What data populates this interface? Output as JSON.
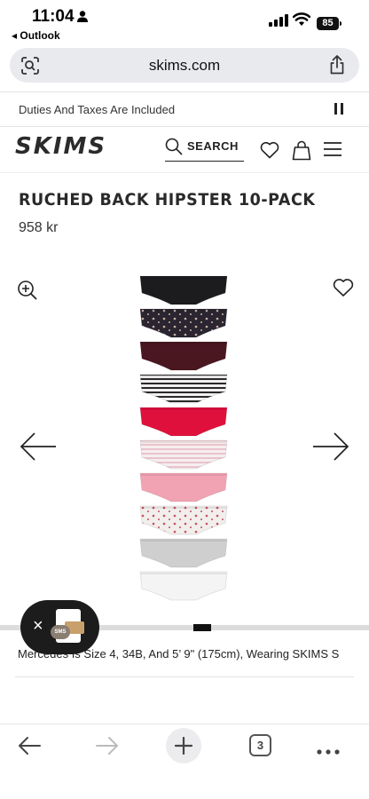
{
  "status_bar": {
    "time": "11:04",
    "back_app": "◂ Outlook",
    "battery": "85"
  },
  "browser": {
    "url": "skims.com",
    "tab_count": "3"
  },
  "site": {
    "announcement": "Duties And Taxes Are Included",
    "logo": "SKIMS",
    "search_label": "SEARCH"
  },
  "product": {
    "title": "RUCHED BACK HIPSTER 10-PACK",
    "price": "958 kr",
    "model_caption": "Mercedes Is Size 4, 34B, And 5’ 9\" (175cm), Wearing SKIMS S",
    "gallery_progress": 0.55,
    "swatches": [
      {
        "name": "black",
        "base": "#1c1c1e",
        "pattern": "none",
        "accent": ""
      },
      {
        "name": "black-print",
        "base": "#2a2530",
        "pattern": "dots",
        "accent": "#c9b2a8"
      },
      {
        "name": "burgundy",
        "base": "#4a1620",
        "pattern": "none",
        "accent": ""
      },
      {
        "name": "black-stripe",
        "base": "#f3eef0",
        "pattern": "stripes",
        "accent": "#2a2a2a"
      },
      {
        "name": "red",
        "base": "#e0103d",
        "pattern": "none",
        "accent": ""
      },
      {
        "name": "pink-stripe",
        "base": "#f6edef",
        "pattern": "stripes",
        "accent": "#e9c4cc"
      },
      {
        "name": "pink",
        "base": "#f2a3b3",
        "pattern": "none",
        "accent": ""
      },
      {
        "name": "white-cherry",
        "base": "#f1eeec",
        "pattern": "dots",
        "accent": "#c7505e"
      },
      {
        "name": "heather-grey",
        "base": "#cfcfd0",
        "pattern": "none",
        "accent": ""
      },
      {
        "name": "white",
        "base": "#f4f4f5",
        "pattern": "none",
        "accent": ""
      }
    ]
  },
  "chat_widget": {
    "close": "×",
    "badge": "SMS"
  },
  "icons": [
    "person-icon",
    "signal-icon",
    "wifi-icon",
    "lens-icon",
    "share-icon",
    "pause-icon",
    "search-icon",
    "heart-icon",
    "bag-icon",
    "menu-icon",
    "zoom-in-icon",
    "arrow-left-icon",
    "arrow-right-icon",
    "back-icon",
    "forward-icon",
    "plus-icon",
    "more-icon"
  ]
}
